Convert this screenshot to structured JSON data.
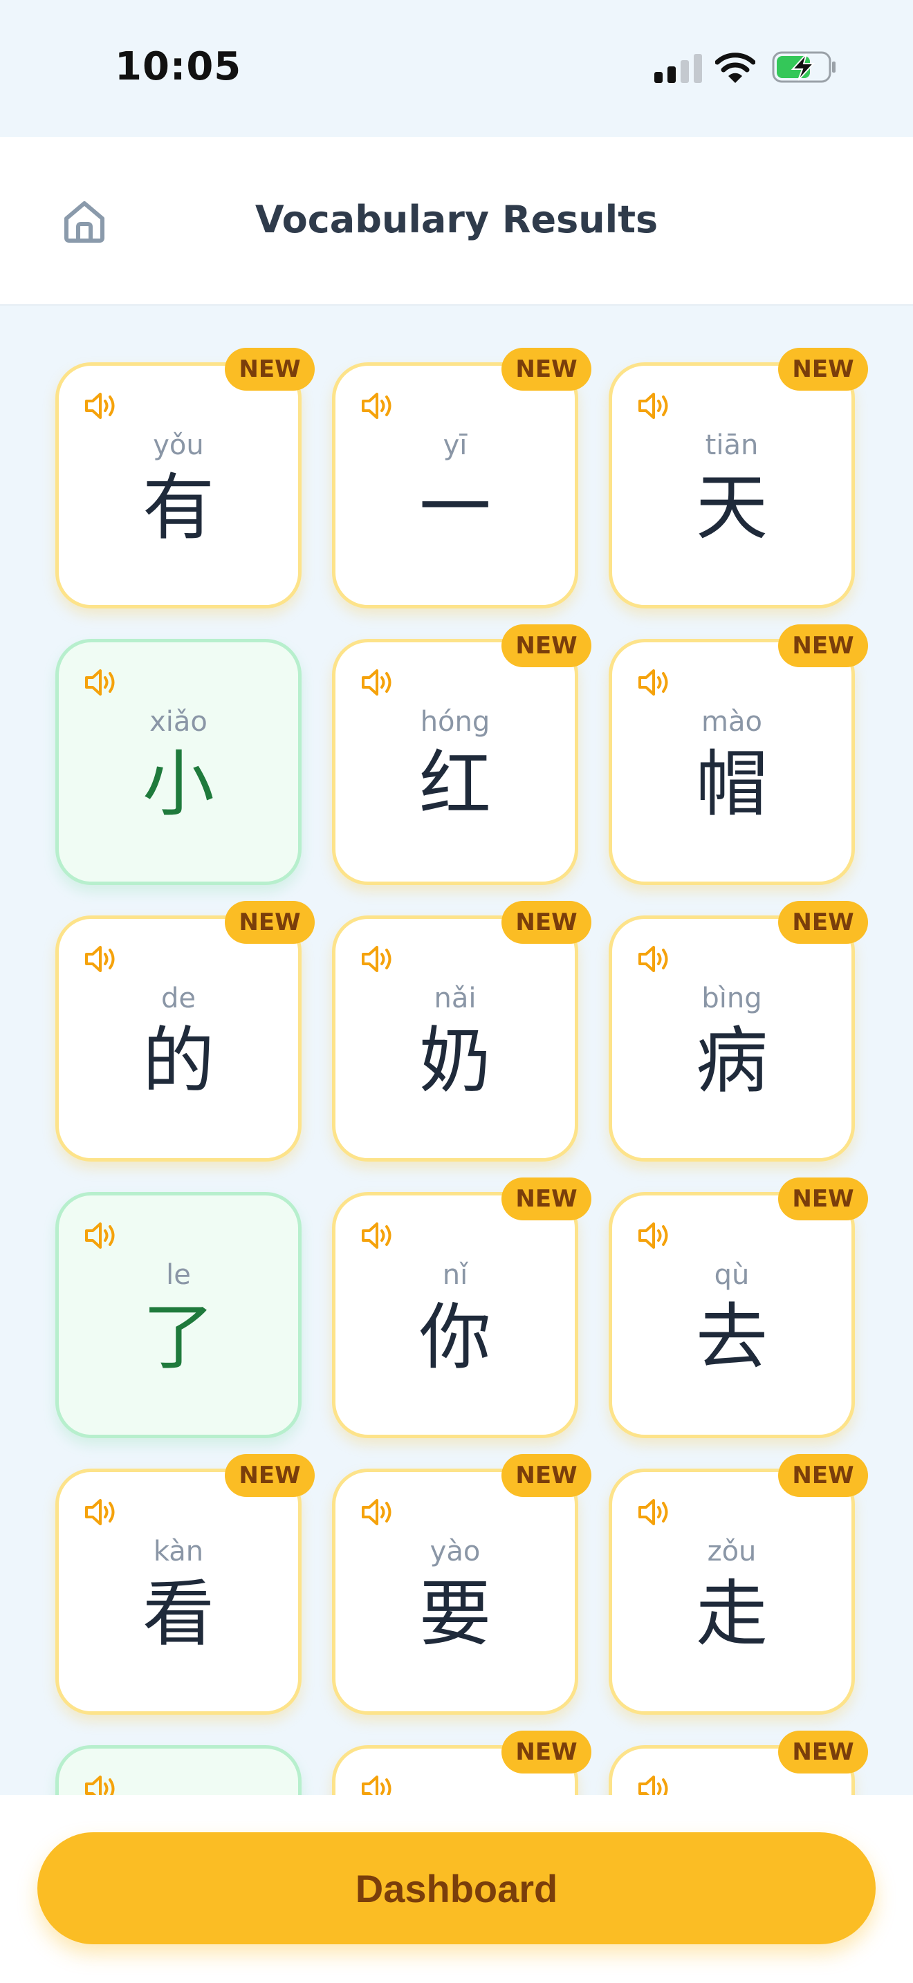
{
  "status": {
    "time": "10:05"
  },
  "header": {
    "title": "Vocabulary Results"
  },
  "badge_label": "NEW",
  "cards": [
    {
      "pinyin": "yǒu",
      "hanzi": "有",
      "new": true
    },
    {
      "pinyin": "yī",
      "hanzi": "一",
      "new": true
    },
    {
      "pinyin": "tiān",
      "hanzi": "天",
      "new": true
    },
    {
      "pinyin": "xiǎo",
      "hanzi": "小",
      "new": false
    },
    {
      "pinyin": "hóng",
      "hanzi": "红",
      "new": true
    },
    {
      "pinyin": "mào",
      "hanzi": "帽",
      "new": true
    },
    {
      "pinyin": "de",
      "hanzi": "的",
      "new": true
    },
    {
      "pinyin": "nǎi",
      "hanzi": "奶",
      "new": true
    },
    {
      "pinyin": "bìng",
      "hanzi": "病",
      "new": true
    },
    {
      "pinyin": "le",
      "hanzi": "了",
      "new": false
    },
    {
      "pinyin": "nǐ",
      "hanzi": "你",
      "new": true
    },
    {
      "pinyin": "qù",
      "hanzi": "去",
      "new": true
    },
    {
      "pinyin": "kàn",
      "hanzi": "看",
      "new": true
    },
    {
      "pinyin": "yào",
      "hanzi": "要",
      "new": true
    },
    {
      "pinyin": "zǒu",
      "hanzi": "走",
      "new": true
    },
    {
      "pinyin": "",
      "hanzi": "",
      "new": false
    },
    {
      "pinyin": "",
      "hanzi": "",
      "new": true
    },
    {
      "pinyin": "",
      "hanzi": "",
      "new": true
    }
  ],
  "footer": {
    "dashboard_label": "Dashboard"
  },
  "colors": {
    "accent": "#fbbd24",
    "known_border": "#b7efcd",
    "new_border": "#fde38a"
  },
  "icons": {
    "home": "home-icon",
    "speaker": "speaker-icon"
  }
}
